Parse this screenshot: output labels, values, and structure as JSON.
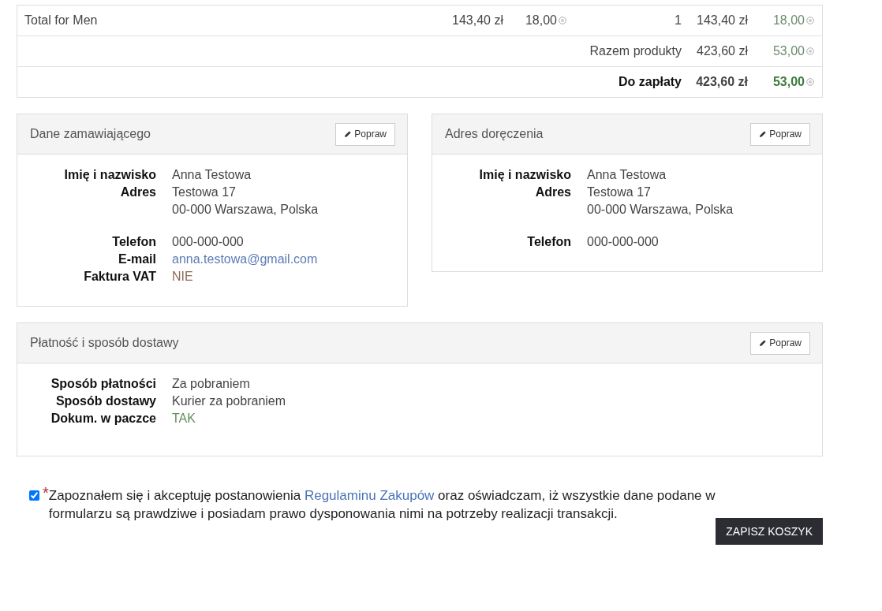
{
  "summary_table": {
    "rows": [
      {
        "kind": "item",
        "label": "Total for Men",
        "price": "143,40 zł",
        "points": "18,00",
        "quantity": "1",
        "total": "143,40 zł",
        "total_points": "18,00"
      },
      {
        "kind": "subtotal",
        "label": "Razem produkty",
        "total": "423,60 zł",
        "total_points": "53,00"
      },
      {
        "kind": "grand_total",
        "label": "Do zapłaty",
        "total": "423,60 zł",
        "total_points": "53,00"
      }
    ]
  },
  "panels": [
    {
      "title": "Dane zamawiającego",
      "edit_button": "Popraw",
      "groups": [
        [
          {
            "label": "Imię i nazwisko",
            "lines": [
              "Anna Testowa"
            ],
            "kind": "text"
          },
          {
            "label": "Adres",
            "lines": [
              "Testowa 17",
              "00-000 Warszawa, Polska"
            ],
            "kind": "text"
          }
        ],
        [
          {
            "label": "Telefon",
            "lines": [
              "000-000-000"
            ],
            "kind": "text"
          },
          {
            "label": "E-mail",
            "lines": [
              "anna.testowa@gmail.com"
            ],
            "kind": "link"
          },
          {
            "label": "Faktura VAT",
            "lines": [
              "NIE"
            ],
            "kind": "negative"
          }
        ]
      ]
    },
    {
      "title": "Adres doręczenia",
      "edit_button": "Popraw",
      "groups": [
        [
          {
            "label": "Imię i nazwisko",
            "lines": [
              "Anna Testowa"
            ],
            "kind": "text"
          },
          {
            "label": "Adres",
            "lines": [
              "Testowa 17",
              "00-000 Warszawa, Polska"
            ],
            "kind": "text"
          }
        ],
        [
          {
            "label": "Telefon",
            "lines": [
              "000-000-000"
            ],
            "kind": "text"
          }
        ]
      ]
    },
    {
      "title": "Płatność i sposób dostawy",
      "edit_button": "Popraw",
      "groups": [
        [
          {
            "label": "Sposób płatności",
            "lines": [
              "Za pobraniem"
            ],
            "kind": "text"
          },
          {
            "label": "Sposób dostawy",
            "lines": [
              "Kurier za pobraniem"
            ],
            "kind": "text"
          },
          {
            "label": "Dokum. w paczce",
            "lines": [
              "TAK"
            ],
            "kind": "positive"
          }
        ]
      ]
    }
  ],
  "consent": {
    "checked": true,
    "required_mark": "*",
    "text_before": "Zapoznałem się i akceptuję postanowienia ",
    "link": "Regulaminu Zakupów",
    "text_after": " oraz oświadczam, iż wszystkie dane podane w formularzu są prawdziwe i posiadam prawo dysponowania nimi na potrzeby realizacji transakcji."
  },
  "save_button": "ZAPISZ KOSZYK"
}
